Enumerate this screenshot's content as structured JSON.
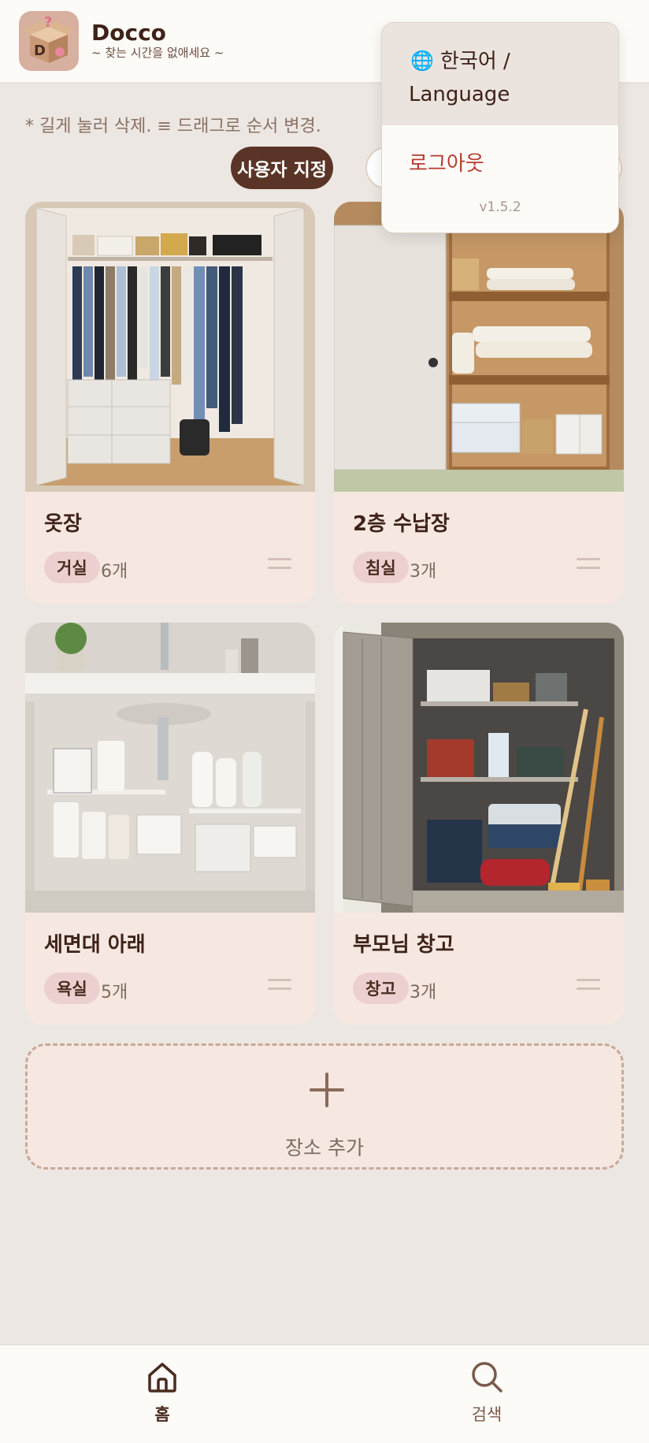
{
  "header": {
    "app_name": "Docco",
    "tagline": "~ 찾는 시간을 없애세요 ~",
    "logo_letter": "D",
    "logo_mark": "?"
  },
  "hint": "* 길게 눌러 삭제. ≡ 드래그로 순서 변경.",
  "filters": {
    "active_label": "사용자 지정"
  },
  "places": [
    {
      "name": "옷장",
      "room": "거실",
      "count": "6개"
    },
    {
      "name": "2층 수납장",
      "room": "침실",
      "count": "3개"
    },
    {
      "name": "세면대 아래",
      "room": "욕실",
      "count": "5개"
    },
    {
      "name": "부모님 창고",
      "room": "창고",
      "count": "3개"
    }
  ],
  "add_place": {
    "label": "장소 추가",
    "icon": "plus-icon"
  },
  "menu": {
    "language_label": "한국어 / Language",
    "language_icon": "globe-icon",
    "logout_label": "로그아웃",
    "version": "v1.5.2"
  },
  "nav": {
    "home": {
      "label": "홈",
      "icon": "home-icon"
    },
    "search": {
      "label": "검색",
      "icon": "search-icon"
    }
  },
  "colors": {
    "accent": "#5a3426",
    "logout": "#b73a2c",
    "card_bg": "#f6e8e1",
    "tag_bg": "#ecd0d0",
    "page_bg": "#ece7e2"
  }
}
